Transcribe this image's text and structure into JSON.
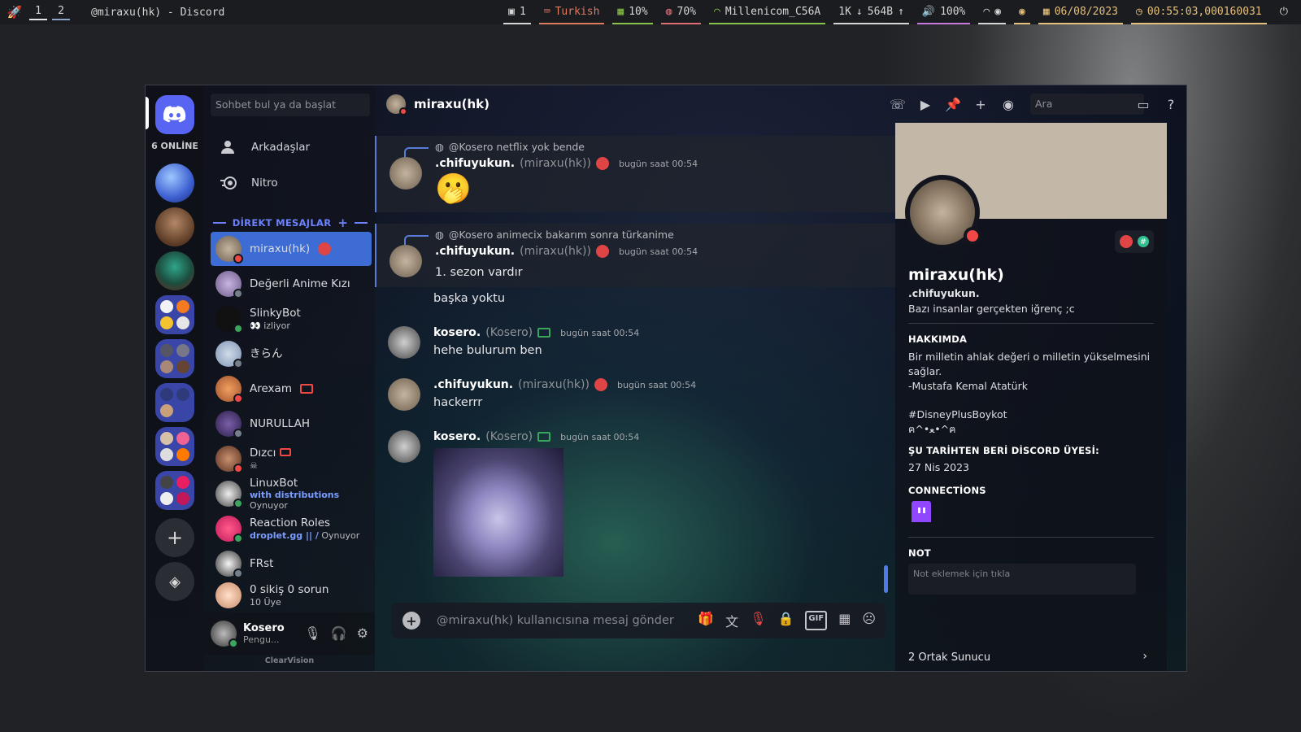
{
  "topbar": {
    "workspaces": [
      "1",
      "2"
    ],
    "window_title": "@miraxu(hk) - Discord",
    "modules": {
      "windows": "1",
      "keyboard": "Turkish",
      "cpu": "10%",
      "mem": "70%",
      "wifi": "Millenicom_C56A",
      "net_down": "1K",
      "net_up": "564B",
      "volume": "100%",
      "date": "06/08/2023",
      "time": "00:55:03,000160031"
    }
  },
  "sidebar": {
    "online_count": "6 ONLİNE",
    "search_placeholder": "Sohbet bul ya da başlat",
    "nav": [
      "Arkadaşlar",
      "Nitro"
    ],
    "dm_header": "DİREKT MESAJLAR",
    "dms": [
      {
        "name": "miraxu(hk)",
        "sub": "",
        "selected": true,
        "status": "dnd"
      },
      {
        "name": "Değerli Anime Kızı",
        "sub": "",
        "status": "offline"
      },
      {
        "name": "SlinkyBot",
        "sub": "👀 izliyor",
        "status": "online"
      },
      {
        "name": "きらん",
        "sub": "",
        "status": "offline"
      },
      {
        "name": "Arexam",
        "sub": "",
        "status": "dnd"
      },
      {
        "name": "NURULLAH",
        "sub": "",
        "status": "offline"
      },
      {
        "name": "Dızcı",
        "sub": "☠",
        "status": "dnd"
      },
      {
        "name": "LinuxBot",
        "sub_bold": "with distributions",
        "sub": "Oynuyor",
        "status": "online"
      },
      {
        "name": "Reaction Roles",
        "sub_bold": "droplet.gg || /",
        "sub": "Oynuyor",
        "status": "online"
      },
      {
        "name": "FRst",
        "sub": "",
        "status": "offline"
      },
      {
        "name": "0 sikiş 0 sorun",
        "sub": "10 Üye",
        "status": ""
      }
    ],
    "user": {
      "name": "Kosero",
      "status": "Pengu..."
    },
    "footer": "ClearVision"
  },
  "header": {
    "title": "miraxu(hk)",
    "search_placeholder": "Ara"
  },
  "messages": [
    {
      "reply": "@Kosero netflix yok bende",
      "author": ".chifuyukun.",
      "username": "(miraxu(hk))",
      "time": "bugün saat 00:54",
      "text": "🫢"
    },
    {
      "reply": "@Kosero animecix bakarım sonra türkanime",
      "author": ".chifuyukun.",
      "username": "(miraxu(hk))",
      "time": "bugün saat 00:54",
      "text": "1. sezon vardır",
      "text2": "başka yoktu"
    },
    {
      "author": "kosero.",
      "username": "(Kosero)",
      "time": "bugün saat 00:54",
      "text": "hehe bulurum ben"
    },
    {
      "author": ".chifuyukun.",
      "username": "(miraxu(hk))",
      "time": "bugün saat 00:54",
      "text": "hackerrr"
    },
    {
      "author": "kosero.",
      "username": "(Kosero)",
      "time": "bugün saat 00:54",
      "text": ""
    }
  ],
  "composer": {
    "placeholder": "@miraxu(hk) kullanıcısına mesaj gönder",
    "gif": "GIF"
  },
  "profile": {
    "name": "miraxu(hk)",
    "username": ".chifuyukun.",
    "status": "Bazı insanlar gerçekten iğrenç ;c",
    "about_label": "HAKKIMDA",
    "about": "Bir milletin ahlak değeri o milletin yükselmesini sağlar.\n-Mustafa Kemal Atatürk\n\n#DisneyPlusBoykot\nฅ^•ﻌ•^ฅ",
    "member_label": "ŞU TARİHTEN BERİ DİSCORD ÜYESİ:",
    "member_since": "27 Nis 2023",
    "connections_label": "CONNECTİONS",
    "note_label": "NOT",
    "note_placeholder": "Not eklemek için tıkla",
    "mutual": "2 Ortak Sunucu"
  },
  "colors": {
    "accent": "#5865f2",
    "selected": "#3c6cd4",
    "dnd": "#f04747",
    "online": "#3ba55d",
    "offline": "#747f8d"
  }
}
